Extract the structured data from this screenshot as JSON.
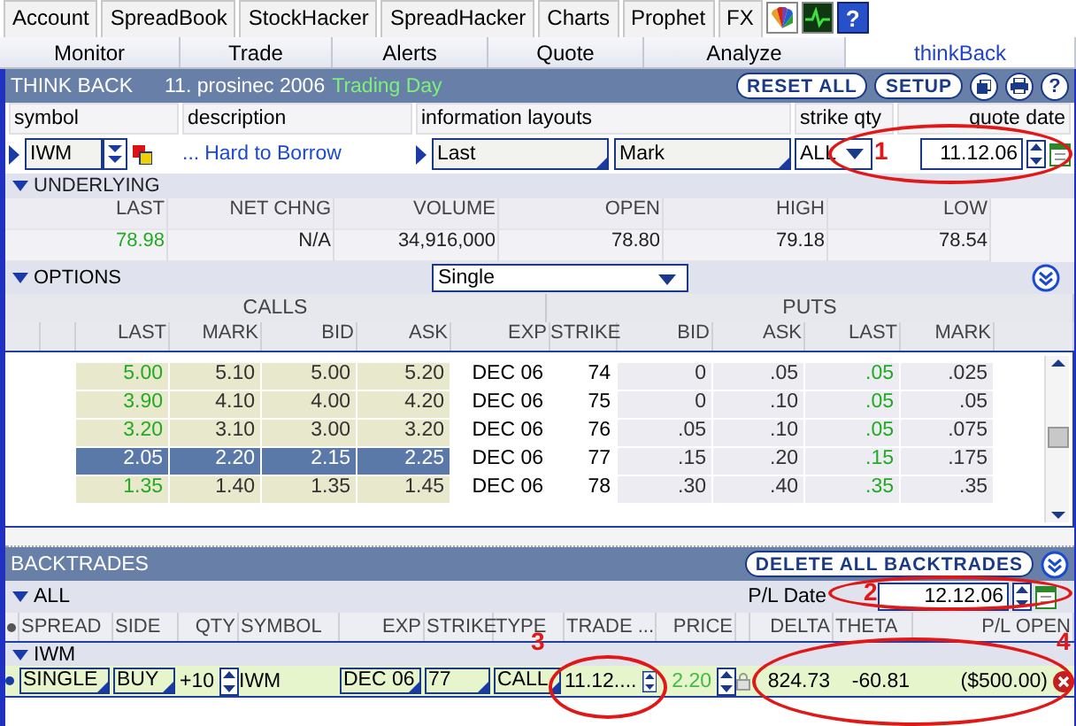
{
  "top_tabs": [
    {
      "label": "Account"
    },
    {
      "label": "SpreadBook"
    },
    {
      "label": "StockHacker"
    },
    {
      "label": "SpreadHacker"
    },
    {
      "label": "Charts"
    },
    {
      "label": "Prophet"
    },
    {
      "label": "FX"
    }
  ],
  "top_icon_buttons": [
    {
      "kind": "news"
    },
    {
      "kind": "pulse"
    },
    {
      "kind": "help",
      "label": "?"
    }
  ],
  "sub_tabs": [
    {
      "label": "Monitor",
      "selected": false
    },
    {
      "label": "Trade",
      "selected": false
    },
    {
      "label": "Alerts",
      "selected": false
    },
    {
      "label": "Quote",
      "selected": false
    },
    {
      "label": "Analyze",
      "selected": false
    },
    {
      "label": "thinkBack",
      "selected": true
    }
  ],
  "header": {
    "title": "THINK BACK",
    "date": "11. prosinec 2006",
    "status": "Trading Day",
    "buttons": [
      "RESET ALL",
      "SETUP"
    ],
    "help_label": "?"
  },
  "query": {
    "labels": [
      "symbol",
      "description",
      "information layouts",
      "strike qty",
      "quote date"
    ],
    "symbol": "IWM",
    "description_prefix": "...",
    "description_link": "Hard to Borrow",
    "layouts": [
      "Last",
      "Mark"
    ],
    "strike_qty": "ALL",
    "quote_date": "11.12.06"
  },
  "underlying": {
    "title": "UNDERLYING",
    "columns": [
      "LAST",
      "NET CHNG",
      "VOLUME",
      "OPEN",
      "HIGH",
      "LOW"
    ],
    "values": [
      {
        "text": "78.98",
        "color": "#22aa22"
      },
      {
        "text": "N/A",
        "color": "#222222"
      },
      {
        "text": "34,916,000",
        "color": "#222222"
      },
      {
        "text": "78.80",
        "color": "#222222"
      },
      {
        "text": "79.18",
        "color": "#222222"
      },
      {
        "text": "78.54",
        "color": "#222222"
      }
    ]
  },
  "options": {
    "title": "OPTIONS",
    "strategy": "Single",
    "calls_label": "CALLS",
    "puts_label": "PUTS",
    "calls_columns": [
      "LAST",
      "MARK",
      "BID",
      "ASK",
      "EXP"
    ],
    "strike_column": "STRIKE",
    "puts_columns": [
      "BID",
      "ASK",
      "LAST",
      "MARK"
    ],
    "rows": [
      {
        "calls": [
          "5.00",
          "5.10",
          "5.00",
          "5.20"
        ],
        "exp": "DEC 06",
        "strike": "74",
        "puts": [
          "0",
          ".05",
          ".05",
          ".025"
        ],
        "selected": false
      },
      {
        "calls": [
          "3.90",
          "4.10",
          "4.00",
          "4.20"
        ],
        "exp": "DEC 06",
        "strike": "75",
        "puts": [
          "0",
          ".10",
          ".05",
          ".05"
        ],
        "selected": false
      },
      {
        "calls": [
          "3.20",
          "3.10",
          "3.00",
          "3.20"
        ],
        "exp": "DEC 06",
        "strike": "76",
        "puts": [
          ".05",
          ".10",
          ".05",
          ".075"
        ],
        "selected": false
      },
      {
        "calls": [
          "2.05",
          "2.20",
          "2.15",
          "2.25"
        ],
        "exp": "DEC 06",
        "strike": "77",
        "puts": [
          ".15",
          ".20",
          ".15",
          ".175"
        ],
        "selected": true
      },
      {
        "calls": [
          "1.35",
          "1.40",
          "1.35",
          "1.45"
        ],
        "exp": "DEC 06",
        "strike": "78",
        "puts": [
          ".30",
          ".40",
          ".35",
          ".35"
        ],
        "selected": false
      }
    ]
  },
  "backtrades": {
    "title": "BACKTRADES",
    "delete_button": "DELETE ALL BACKTRADES",
    "group_all": "ALL",
    "pl_date_label": "P/L Date",
    "pl_date": "12.12.06",
    "columns": [
      "SPREAD",
      "SIDE",
      "QTY",
      "SYMBOL",
      "EXP",
      "STRIKE",
      "TYPE",
      "TRADE ...",
      "PRICE",
      "DELTA",
      "THETA",
      "P/L OPEN"
    ],
    "group": "IWM",
    "trade": {
      "spread": "SINGLE",
      "side": "BUY",
      "qty": "+10",
      "symbol": "IWM",
      "exp": "DEC 06",
      "strike": "77",
      "type": "CALL",
      "trade_date": "11.12....",
      "price": "2.20",
      "delta": "824.73",
      "theta": "-60.81",
      "pl_open": "($500.00)"
    }
  },
  "annotations": [
    {
      "label": "1"
    },
    {
      "label": "2"
    },
    {
      "label": "3"
    },
    {
      "label": "4"
    }
  ]
}
